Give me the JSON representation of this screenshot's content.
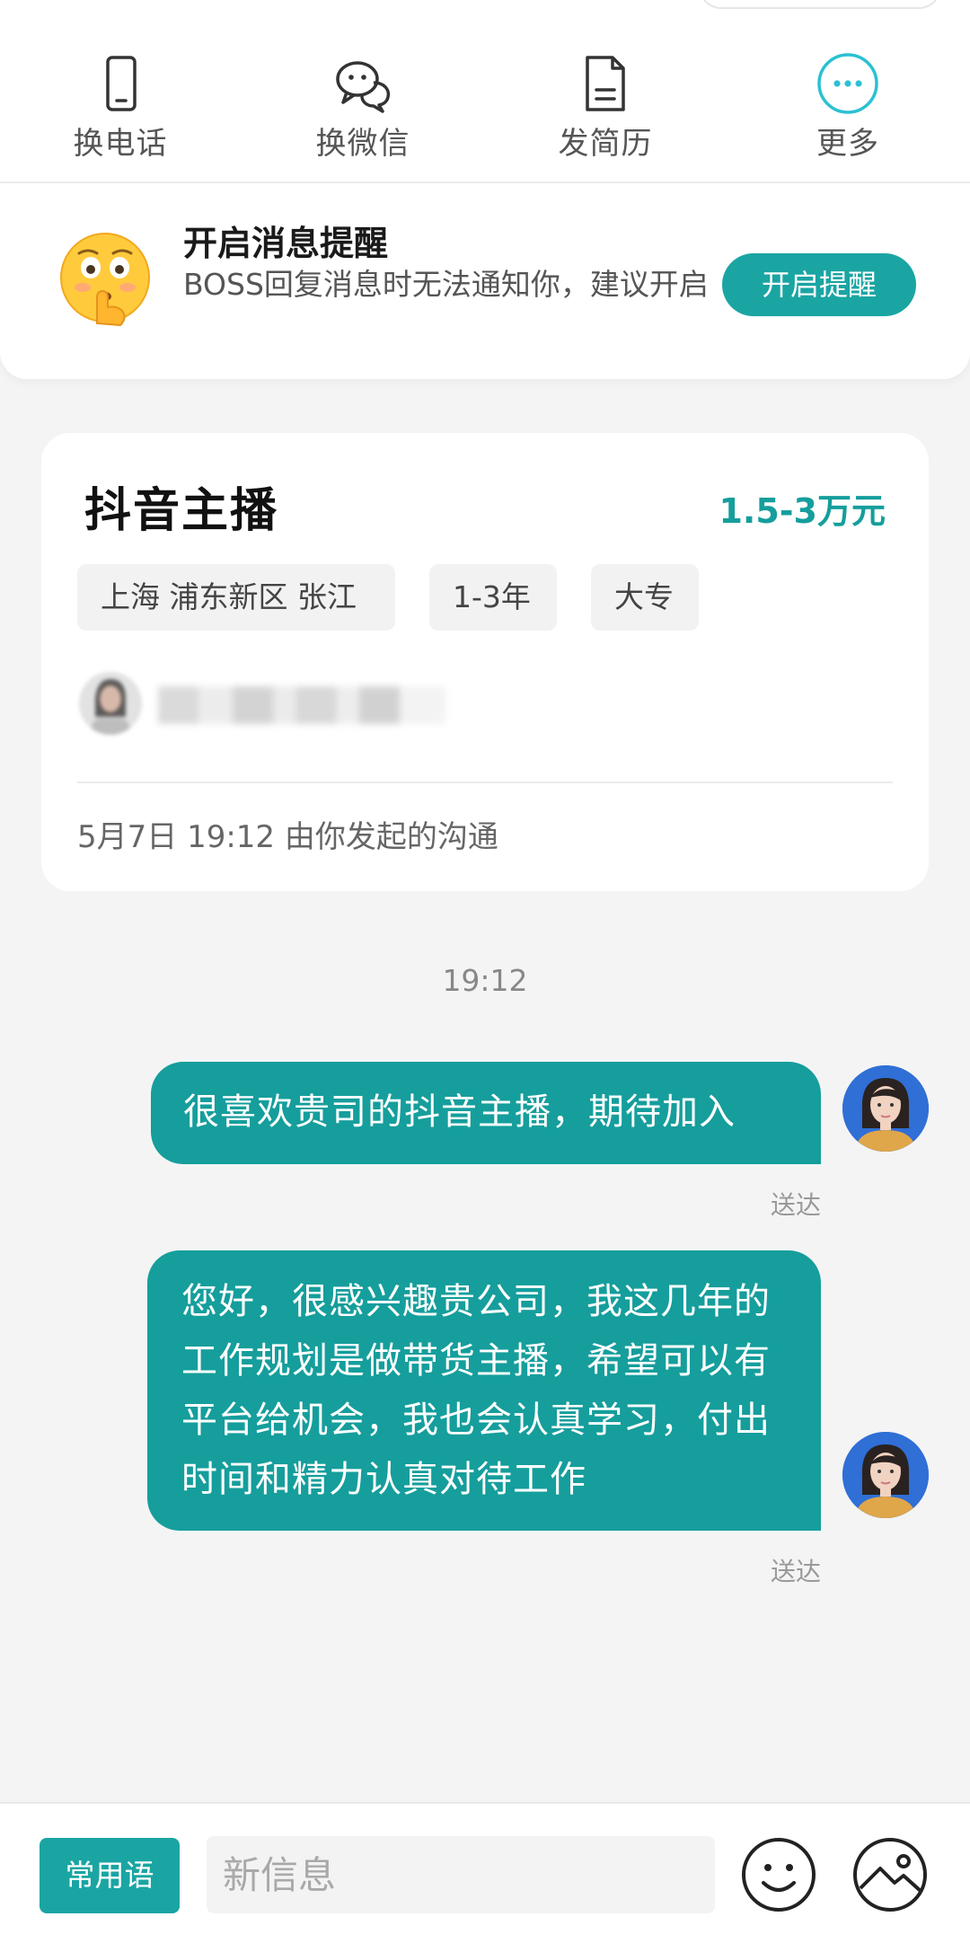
{
  "actions": [
    {
      "label": "换电话",
      "icon": "phone-icon"
    },
    {
      "label": "换微信",
      "icon": "wechat-icon"
    },
    {
      "label": "发简历",
      "icon": "resume-icon"
    },
    {
      "label": "更多",
      "icon": "more-icon"
    }
  ],
  "notification": {
    "title": "开启消息提醒",
    "description": "BOSS回复消息时无法通知你，建议开启",
    "button": "开启提醒",
    "emoji": "shushing-face-emoji"
  },
  "job": {
    "title": "抖音主播",
    "salary": "1.5-3万元",
    "tags": [
      "上海 浦东新区 张江",
      "1-3年",
      "大专"
    ],
    "started": "5月7日 19:12 由你发起的沟通"
  },
  "chat": {
    "time": "19:12",
    "messages": [
      {
        "text": "很喜欢贵司的抖音主播，期待加入",
        "status": "送达"
      },
      {
        "text": "您好，很感兴趣贵公司，我这几年的工作规划是做带货主播，希望可以有平台给机会，我也会认真学习，付出时间和精力认真对待工作",
        "status": "送达"
      }
    ]
  },
  "input_bar": {
    "phrases_button": "常用语",
    "placeholder": "新信息"
  },
  "colors": {
    "accent": "#159e9c",
    "button": "#1aa5a3",
    "more_icon": "#2bc1d2",
    "background": "#f4f4f5"
  }
}
